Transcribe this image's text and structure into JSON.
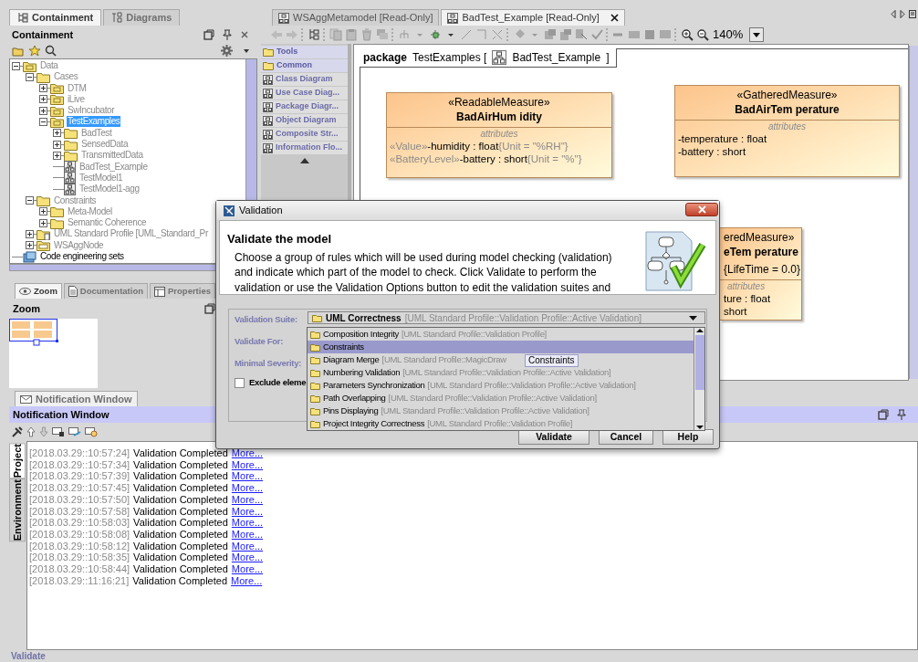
{
  "containment": {
    "tabs": [
      {
        "label": "Containment",
        "selected": true
      },
      {
        "label": "Diagrams",
        "selected": false
      }
    ],
    "title": "Containment",
    "tree": [
      {
        "label": "Data",
        "kind": "package",
        "expanded": true,
        "selected": false,
        "children": [
          {
            "label": "Cases",
            "kind": "folder",
            "expanded": true,
            "selected": false,
            "children": [
              {
                "label": "DTM",
                "kind": "package",
                "expanded": false,
                "selected": false
              },
              {
                "label": "iLive",
                "kind": "package",
                "expanded": false,
                "selected": false
              },
              {
                "label": "SwIncubator",
                "kind": "package",
                "expanded": false,
                "selected": false
              },
              {
                "label": "TestExamples",
                "kind": "package",
                "expanded": true,
                "selected": true,
                "children": [
                  {
                    "label": "BadTest",
                    "kind": "folder",
                    "expanded": false,
                    "selected": false
                  },
                  {
                    "label": "SensedData",
                    "kind": "folder",
                    "expanded": false,
                    "selected": false
                  },
                  {
                    "label": "TransmittedData",
                    "kind": "folder",
                    "expanded": false,
                    "selected": false
                  },
                  {
                    "label": "BadTest_Example",
                    "kind": "diagram",
                    "selected": false
                  },
                  {
                    "label": "TestModel1",
                    "kind": "diagram",
                    "selected": false
                  },
                  {
                    "label": "TestModel1-agg",
                    "kind": "diagram",
                    "selected": false
                  }
                ]
              }
            ]
          },
          {
            "label": "Constraints",
            "kind": "folder",
            "expanded": true,
            "selected": false,
            "children": [
              {
                "label": "Meta-Model",
                "kind": "folder",
                "expanded": false,
                "selected": false
              },
              {
                "label": "Semantic Coherence",
                "kind": "folder",
                "expanded": false,
                "selected": false
              }
            ]
          },
          {
            "label": "UML Standard Profile [UML_Standard_Pr",
            "kind": "profile",
            "expanded": false,
            "selected": false
          },
          {
            "label": "WSAggNode",
            "kind": "node",
            "expanded": false,
            "selected": false
          }
        ]
      },
      {
        "label": "Code engineering sets",
        "kind": "sets",
        "selected": false
      }
    ]
  },
  "zoom_panel": {
    "tabs": [
      {
        "label": "Zoom",
        "selected": true
      },
      {
        "label": "Documentation",
        "selected": false
      },
      {
        "label": "Properties",
        "selected": false
      }
    ],
    "title": "Zoom"
  },
  "editor": {
    "tabs": [
      {
        "label": "WSAggMetamodel [Read-Only]",
        "selected": false
      },
      {
        "label": "BadTest_Example [Read-Only]",
        "selected": true
      }
    ],
    "zoom": "140%",
    "palette": [
      {
        "label": "Tools",
        "kind": "folder"
      },
      {
        "label": "Common",
        "kind": "folder"
      },
      {
        "label": "Class Diagram",
        "kind": "diagram"
      },
      {
        "label": "Use Case Diag...",
        "kind": "diagram"
      },
      {
        "label": "Package Diagr...",
        "kind": "diagram"
      },
      {
        "label": "Object Diagram",
        "kind": "diagram"
      },
      {
        "label": "Composite Str...",
        "kind": "diagram"
      },
      {
        "label": "Information Flo...",
        "kind": "diagram"
      }
    ],
    "frame": {
      "keyword": "package",
      "owner": "TestExamples [",
      "diagram": "BadTest_Example",
      "end": "]"
    },
    "classes": [
      {
        "stereotype": "«ReadableMeasure»",
        "name": "BadAirHum idity",
        "compartment": "attributes",
        "attributes": [
          {
            "prefix": "«Value»",
            "text": "-humidity : float",
            "suffix": "{Unit = \"%RH\"}"
          },
          {
            "prefix": "«BatteryLevel»",
            "text": "-battery : short",
            "suffix": "{Unit = \"%\"}"
          }
        ]
      },
      {
        "stereotype": "«GatheredMeasure»",
        "name": "BadAirTem perature",
        "compartment": "attributes",
        "attributes": [
          {
            "text": "-temperature : float"
          },
          {
            "text": "-battery : short"
          }
        ]
      },
      {
        "stereotype": "eredMeasure»",
        "name": "eTem perature",
        "tags": "{LifeTime = 0.0}",
        "compartment": "attributes",
        "attributes": [
          {
            "text": "ture : float"
          },
          {
            "text": "short"
          }
        ]
      }
    ]
  },
  "notification": {
    "tab": "Notification Window",
    "title": "Notification Window",
    "side_tabs": [
      {
        "label": "Project",
        "selected": true
      },
      {
        "label": "Environment",
        "selected": false
      }
    ],
    "entries": [
      {
        "time": "[2018.03.29::10:57:24]",
        "message": "Validation Completed",
        "link": "More..."
      },
      {
        "time": "[2018.03.29::10:57:34]",
        "message": "Validation Completed",
        "link": "More..."
      },
      {
        "time": "[2018.03.29::10:57:39]",
        "message": "Validation Completed",
        "link": "More..."
      },
      {
        "time": "[2018.03.29::10:57:45]",
        "message": "Validation Completed",
        "link": "More..."
      },
      {
        "time": "[2018.03.29::10:57:50]",
        "message": "Validation Completed",
        "link": "More..."
      },
      {
        "time": "[2018.03.29::10:57:58]",
        "message": "Validation Completed",
        "link": "More..."
      },
      {
        "time": "[2018.03.29::10:58:03]",
        "message": "Validation Completed",
        "link": "More..."
      },
      {
        "time": "[2018.03.29::10:58:08]",
        "message": "Validation Completed",
        "link": "More..."
      },
      {
        "time": "[2018.03.29::10:58:12]",
        "message": "Validation Completed",
        "link": "More..."
      },
      {
        "time": "[2018.03.29::10:58:35]",
        "message": "Validation Completed",
        "link": "More..."
      },
      {
        "time": "[2018.03.29::10:58:44]",
        "message": "Validation Completed",
        "link": "More..."
      },
      {
        "time": "[2018.03.29::11:16:21]",
        "message": "Validation Completed",
        "link": "More..."
      }
    ]
  },
  "dialog": {
    "title": "Validation",
    "heading": "Validate the model",
    "description": "Choose a group of rules which will be used during model checking (validation) and indicate which part of the model to check. Click Validate to perform the validation or use the Validation Options button to edit the validation suites and",
    "labels": [
      "Validation Suite:",
      "Validate For:",
      "Minimal Severity:"
    ],
    "suite": {
      "name": "UML Correctness",
      "path": "[UML Standard Profile::Validation Profile::Active Validation]"
    },
    "exclude": {
      "label": "Exclude eleme",
      "checked": false
    },
    "options": [
      {
        "name": "Composition Integrity",
        "path": "[UML Standard Profile::Validation Profile]",
        "selected": false
      },
      {
        "name": "Constraints",
        "selected": true
      },
      {
        "name": "Diagram Merge",
        "path": "[UML Standard Profile::MagicDraw",
        "selected": false
      },
      {
        "name": "Numbering Validation",
        "path": "[UML Standard Profile::Validation Profile::Active Validation]",
        "selected": false
      },
      {
        "name": "Parameters Synchronization",
        "path": "[UML Standard Profile::Validation Profile::Active Validation]",
        "selected": false
      },
      {
        "name": "Path Overlapping",
        "path": "[UML Standard Profile::Validation Profile::Active Validation]",
        "selected": false
      },
      {
        "name": "Pins Displaying",
        "path": "[UML Standard Profile::Validation Profile::Active Validation]",
        "selected": false
      },
      {
        "name": "Project Integrity Correctness",
        "path": "[UML Standard Profile::Validation Profile]",
        "selected": false
      }
    ],
    "tooltip": "Constraints",
    "buttons": [
      "Validate",
      "Cancel",
      "Help"
    ]
  },
  "status_bar": {
    "text": "Validate"
  }
}
